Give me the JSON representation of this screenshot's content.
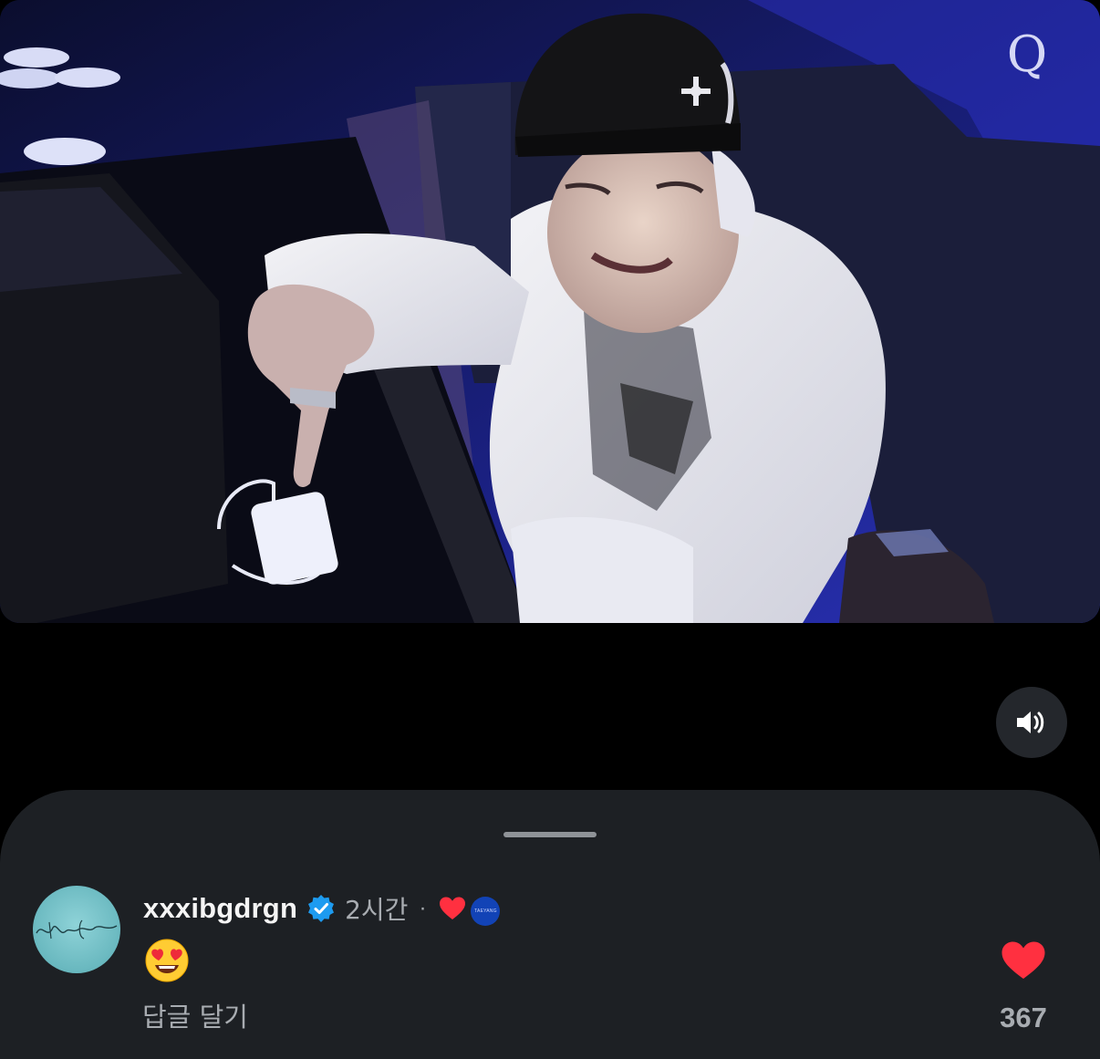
{
  "video": {
    "channel_logo_text": "Q",
    "mute_icon": "speaker-volume-icon"
  },
  "comment": {
    "avatar_text": "Mmmm G Dragon",
    "username": "xxxibgdrgn",
    "verified_icon": "verified-badge-icon",
    "time": "2시간",
    "separator": "·",
    "creator_like_icon": "red-heart-icon",
    "creator_badge_text": "TAEYANG",
    "body_emoji": "smiling-face-with-heart-eyes-emoji",
    "reply_label": "답글 달기",
    "like_icon": "red-heart-icon",
    "like_count": "367"
  },
  "colors": {
    "sheet_background": "#1d2024",
    "verified_blue": "#1d9bf0",
    "heart_red": "#ff3040",
    "badge_blue": "#1243b6",
    "muted_text": "#a8acb1"
  }
}
